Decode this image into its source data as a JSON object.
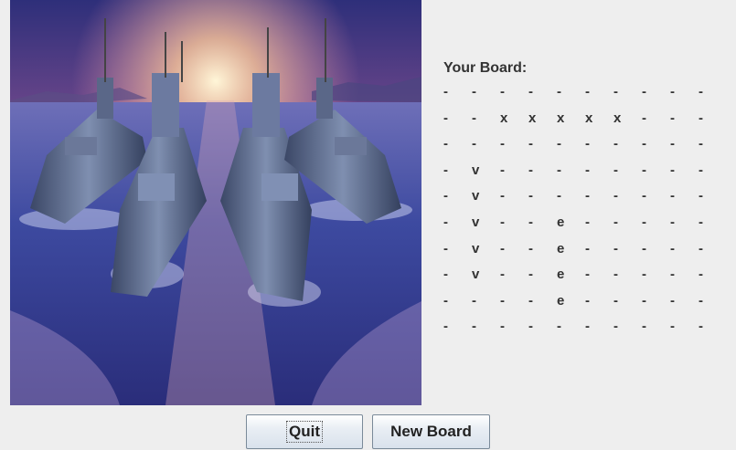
{
  "board": {
    "title": "Your Board:",
    "rows": [
      [
        "-",
        "-",
        "-",
        "-",
        "-",
        "-",
        "-",
        "-",
        "-",
        "-"
      ],
      [
        "-",
        "-",
        "x",
        "x",
        "x",
        "x",
        "x",
        "-",
        "-",
        "-"
      ],
      [
        "-",
        "-",
        "-",
        "-",
        "-",
        "-",
        "-",
        "-",
        "-",
        "-"
      ],
      [
        "-",
        "v",
        "-",
        "-",
        "-",
        "-",
        "-",
        "-",
        "-",
        "-"
      ],
      [
        "-",
        "v",
        "-",
        "-",
        "-",
        "-",
        "-",
        "-",
        "-",
        "-"
      ],
      [
        "-",
        "v",
        "-",
        "-",
        "e",
        "-",
        "-",
        "-",
        "-",
        "-"
      ],
      [
        "-",
        "v",
        "-",
        "-",
        "e",
        "-",
        "-",
        "-",
        "-",
        "-"
      ],
      [
        "-",
        "v",
        "-",
        "-",
        "e",
        "-",
        "-",
        "-",
        "-",
        "-"
      ],
      [
        "-",
        "-",
        "-",
        "-",
        "e",
        "-",
        "-",
        "-",
        "-",
        "-"
      ],
      [
        "-",
        "-",
        "-",
        "-",
        "-",
        "-",
        "-",
        "-",
        "-",
        "-"
      ]
    ]
  },
  "buttons": {
    "quit_label": "Quit",
    "new_board_label": "New Board"
  },
  "colors": {
    "background": "#eeeeee",
    "text": "#333333",
    "sky_top": "#3a3f8f",
    "sunset": "#ffd08a",
    "sea": "#2d3a8c"
  }
}
